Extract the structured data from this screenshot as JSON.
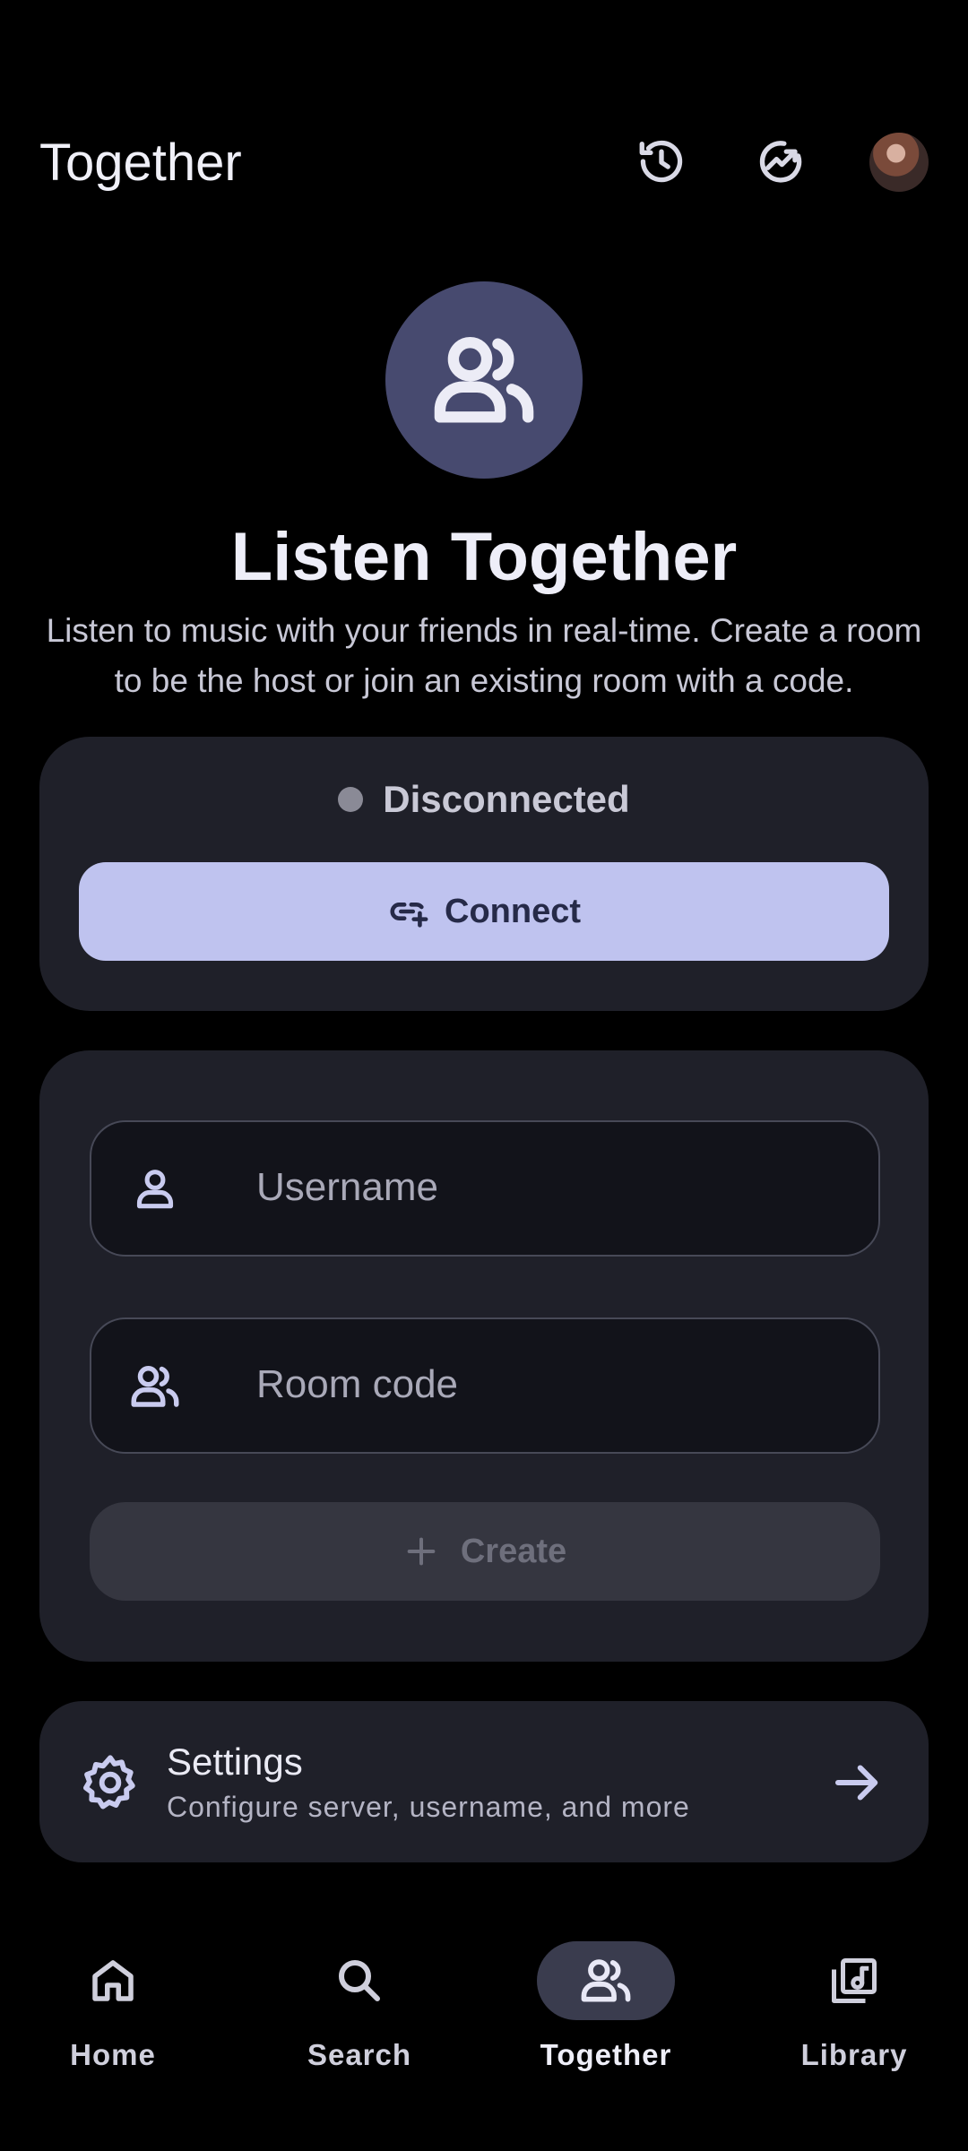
{
  "header": {
    "title": "Together",
    "icons": [
      "history-icon",
      "trending-icon"
    ],
    "avatar": "profile-avatar"
  },
  "hero": {
    "icon": "people-icon",
    "title": "Listen Together",
    "description": "Listen to music with your friends in real-time. Create a room to be the host or join an existing room with a code."
  },
  "connection": {
    "status": "Disconnected",
    "button_label": "Connect",
    "button_icon": "link-add-icon"
  },
  "form": {
    "username_placeholder": "Username",
    "room_code_placeholder": "Room code",
    "create_label": "Create",
    "create_icon": "plus-icon"
  },
  "settings": {
    "title": "Settings",
    "subtitle": "Configure server, username, and more"
  },
  "nav": {
    "items": [
      {
        "label": "Home",
        "icon": "home-icon"
      },
      {
        "label": "Search",
        "icon": "search-icon"
      },
      {
        "label": "Together",
        "icon": "people-icon"
      },
      {
        "label": "Library",
        "icon": "library-icon"
      }
    ],
    "active": "Together"
  },
  "colors": {
    "accent": "#bfc3ef",
    "card": "#1f2029",
    "hero_circle": "#474a6f"
  }
}
